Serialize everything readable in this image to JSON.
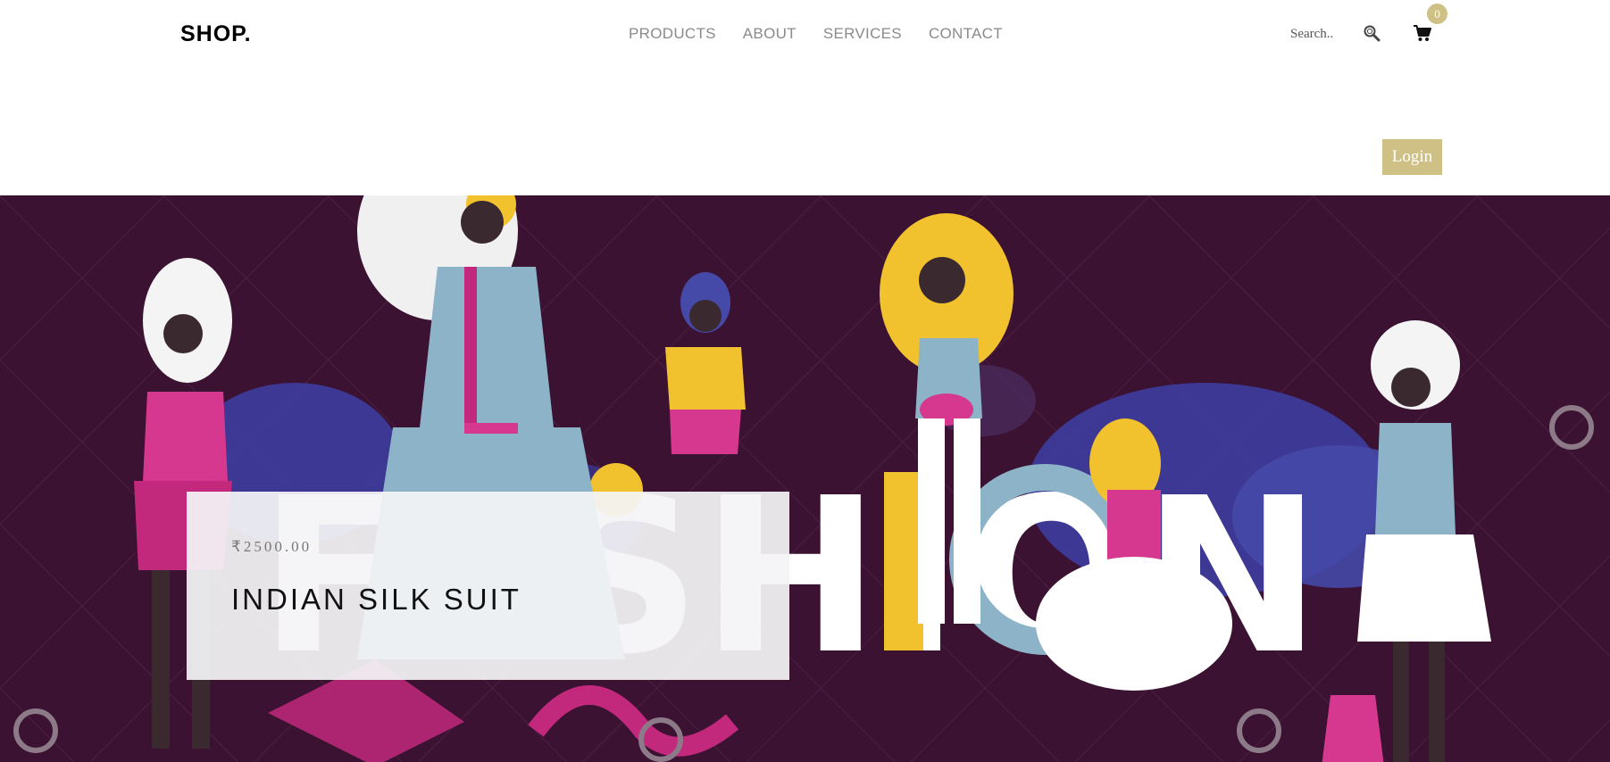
{
  "header": {
    "logo": "SHOP.",
    "nav": [
      {
        "label": "PRODUCTS"
      },
      {
        "label": "ABOUT"
      },
      {
        "label": "SERVICES"
      },
      {
        "label": "CONTACT"
      }
    ],
    "search": {
      "placeholder": "Search.."
    },
    "cart": {
      "count": "0"
    },
    "login_label": "Login"
  },
  "hero": {
    "product": {
      "price": "₹2500.00",
      "name": "INDIAN SILK SUIT"
    },
    "banner_word": "FASHION"
  },
  "colors": {
    "accent": "#cfc085",
    "hero_bg": "#3b1231",
    "nav_text": "#8a8a8a"
  }
}
